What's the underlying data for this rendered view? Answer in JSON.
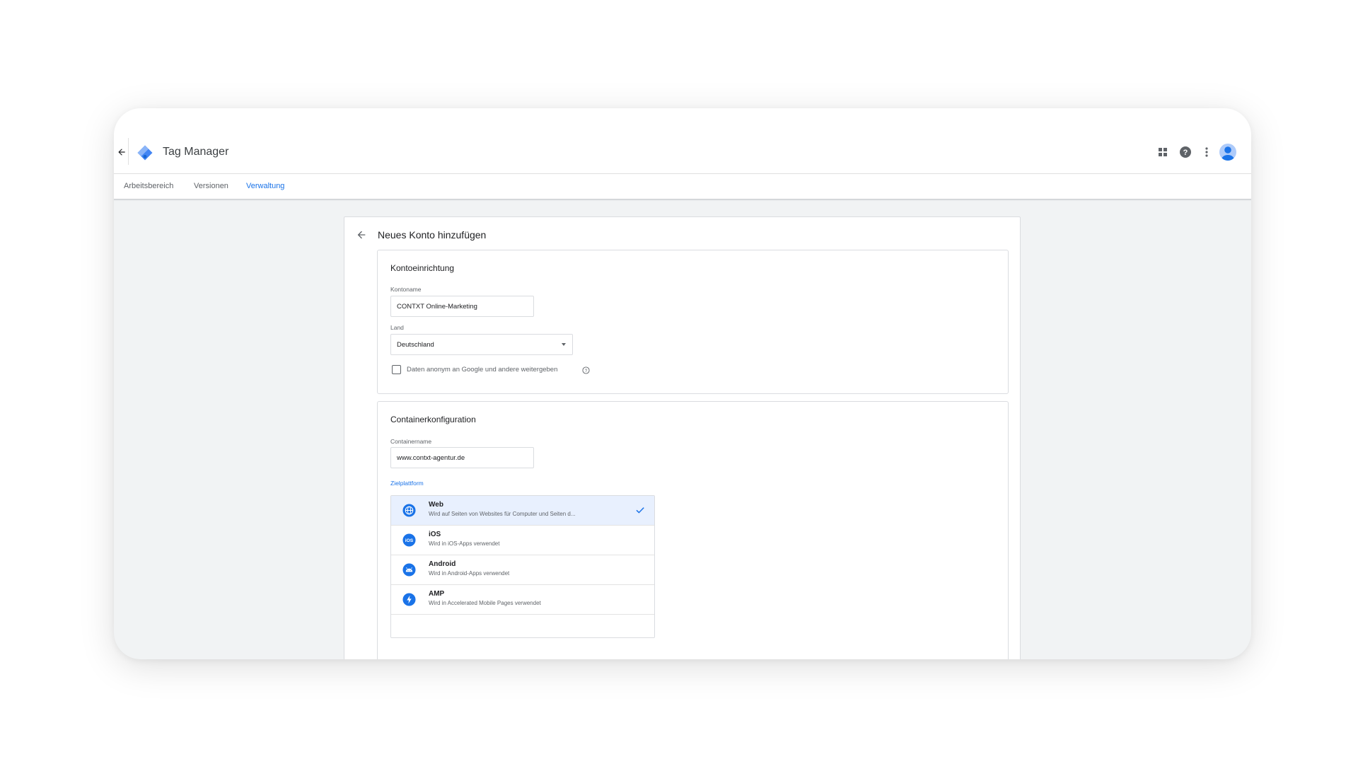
{
  "app": {
    "title": "Tag Manager"
  },
  "nav": {
    "tabs": [
      {
        "label": "Arbeitsbereich",
        "active": false
      },
      {
        "label": "Versionen",
        "active": false
      },
      {
        "label": "Verwaltung",
        "active": true
      }
    ]
  },
  "header_icons": [
    "apps-grid-icon",
    "help-icon",
    "more-vert-icon",
    "account-avatar"
  ],
  "page": {
    "title": "Neues Konto hinzufügen"
  },
  "account_setup": {
    "title": "Kontoeinrichtung",
    "account_name_label": "Kontoname",
    "account_name_value": "CONTXT Online-Marketing",
    "country_label": "Land",
    "country_value": "Deutschland",
    "share_data_label": "Daten anonym an Google und andere weitergeben",
    "share_data_checked": false
  },
  "container_setup": {
    "title": "Containerkonfiguration",
    "container_name_label": "Containername",
    "container_name_value": "www.contxt-agentur.de",
    "platform_label": "Zielplattform",
    "platforms": [
      {
        "name": "Web",
        "description": "Wird auf Seiten von Websites für Computer und Seiten d...",
        "icon": "globe-icon",
        "selected": true
      },
      {
        "name": "iOS",
        "description": "Wird in iOS-Apps verwendet",
        "icon": "ios-icon",
        "selected": false
      },
      {
        "name": "Android",
        "description": "Wird in Android-Apps verwendet",
        "icon": "android-icon",
        "selected": false
      },
      {
        "name": "AMP",
        "description": "Wird in Accelerated Mobile Pages verwendet",
        "icon": "amp-bolt-icon",
        "selected": false
      }
    ]
  },
  "colors": {
    "accent": "#1a73e8",
    "background": "#f1f3f4",
    "selected_row": "#e8f0fe"
  }
}
